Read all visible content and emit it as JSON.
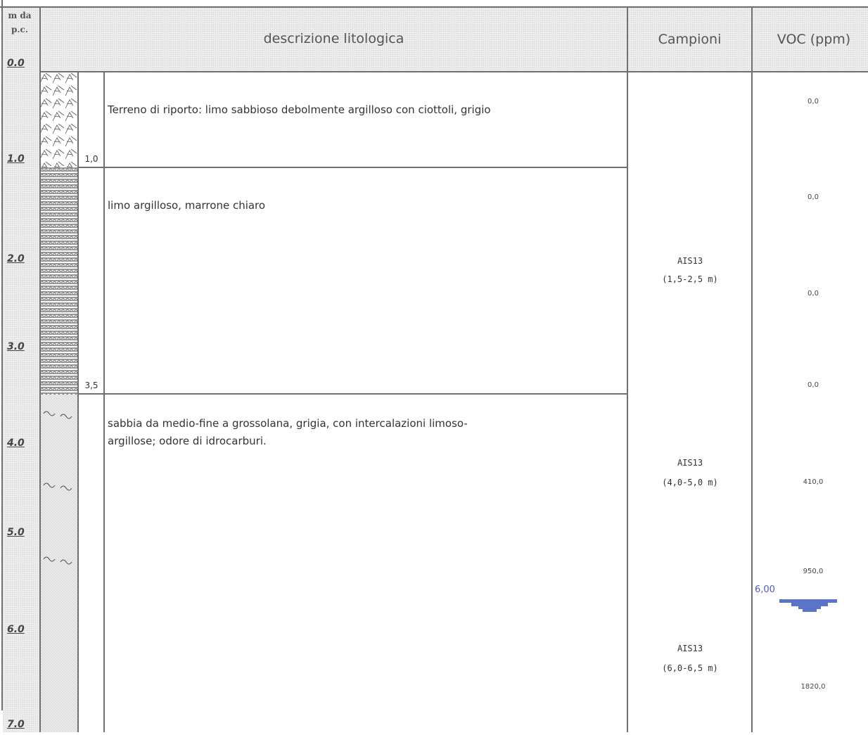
{
  "header": {
    "depth_header_line1": "m da",
    "depth_header_line2": "p.c.",
    "description_title": "descrizione litologica",
    "samples_title": "Campioni",
    "voc_title": "VOC (ppm)"
  },
  "depth_scale": [
    "0.0",
    "1.0",
    "2.0",
    "3.0",
    "4.0",
    "5.0",
    "6.0",
    "7.0"
  ],
  "layers": [
    {
      "description": "Terreno di riporto: limo sabbioso debolmente argilloso con ciottoli, grigio",
      "bottom_depth": "1,0"
    },
    {
      "description": "limo argilloso, marrone chiaro",
      "bottom_depth": "3,5"
    },
    {
      "description_line1": "sabbia da medio-fine a grossolana, grigia, con intercalazioni limoso-",
      "description_line2": "argillose; odore di idrocarburi."
    }
  ],
  "samples": [
    {
      "name": "AIS13",
      "range": "(1,5-2,5 m)"
    },
    {
      "name": "AIS13",
      "range": "(4,0-5,0 m)"
    },
    {
      "name": "AIS13",
      "range": "(6,0-6,5 m)"
    }
  ],
  "voc_readings": [
    "0,0",
    "0,0",
    "0,0",
    "0,0",
    "410,0",
    "950,0",
    "1820,0"
  ],
  "water_level": {
    "label": "6,00",
    "color": "#5b74c6"
  },
  "colors": {
    "line": "#6f6f6f",
    "header_bg": "#ececec"
  }
}
